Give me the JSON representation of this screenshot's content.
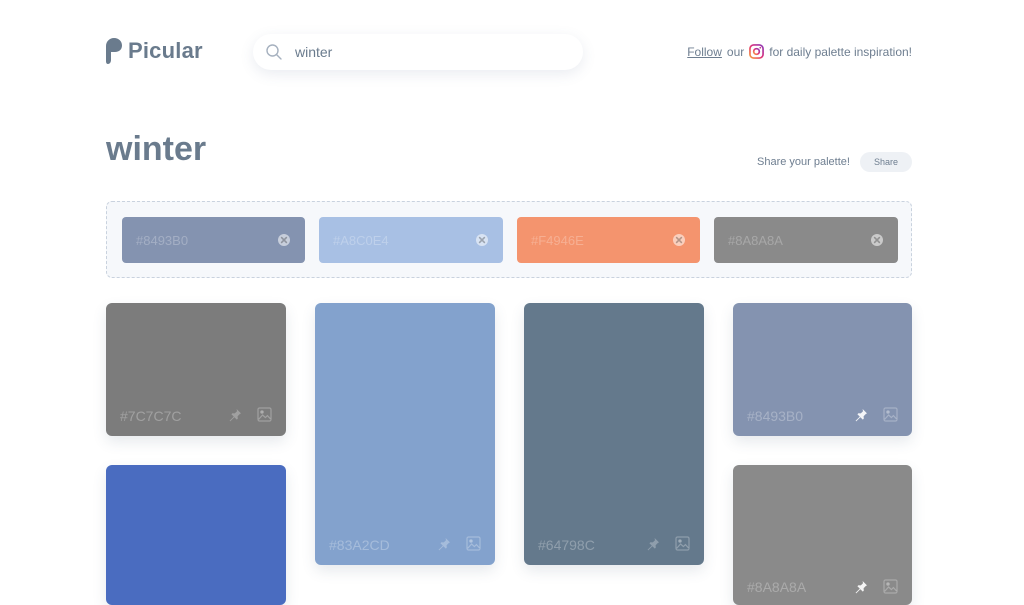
{
  "brand": {
    "name": "Picular"
  },
  "search": {
    "value": "winter"
  },
  "promo": {
    "link": "Follow",
    "mid": "our",
    "tail": "for daily palette inspiration!",
    "icon": "instagram-icon"
  },
  "page": {
    "title": "winter"
  },
  "share": {
    "text": "Share your palette!",
    "button": "Share"
  },
  "palette": [
    {
      "hex": "#8493B0",
      "color": "#8493b0"
    },
    {
      "hex": "#A8C0E4",
      "color": "#a8c0e4"
    },
    {
      "hex": "#F4946E",
      "color": "#f4946e"
    },
    {
      "hex": "#8A8A8A",
      "color": "#8a8a8a"
    }
  ],
  "cards": [
    {
      "hex": "#7C7C7C",
      "color": "#7c7c7c",
      "pin_active": false
    },
    {
      "hex": "",
      "color": "#4a6cc0",
      "pin_active": false
    },
    {
      "hex": "#83A2CD",
      "color": "#83a2cd",
      "pin_active": false
    },
    {
      "hex": "#64798C",
      "color": "#64798c",
      "pin_active": false
    },
    {
      "hex": "#8493B0",
      "color": "#8493b0",
      "pin_active": true
    },
    {
      "hex": "#8A8A8A",
      "color": "#8a8a8a",
      "pin_active": true
    }
  ]
}
